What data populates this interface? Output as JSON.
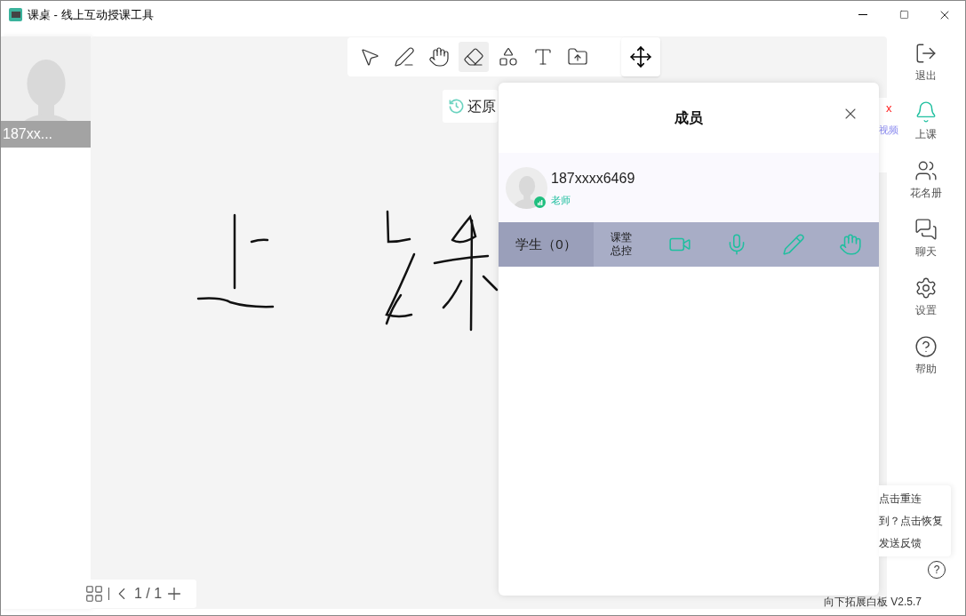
{
  "window": {
    "title": "课桌 - 线上互动授课工具"
  },
  "video_tile": {
    "name": "187xx..."
  },
  "toolbar": {
    "tools": [
      {
        "kind": "select",
        "selected": false
      },
      {
        "kind": "pen",
        "selected": false
      },
      {
        "kind": "hand",
        "selected": false
      },
      {
        "kind": "eraser",
        "selected": true
      },
      {
        "kind": "shapes",
        "selected": false
      },
      {
        "kind": "text",
        "selected": false
      },
      {
        "kind": "upload",
        "selected": false
      }
    ]
  },
  "restore_button": {
    "label": "还原"
  },
  "side_card": {
    "close": "x",
    "label": "视频"
  },
  "members_panel": {
    "title": "成员",
    "teacher": {
      "name": "187xxxx6469",
      "role": "老师"
    },
    "students_tab": {
      "label": "学生（0）"
    },
    "class_control": {
      "label": "课堂总控"
    },
    "controls": [
      {
        "kind": "camera"
      },
      {
        "kind": "mic"
      },
      {
        "kind": "pen"
      },
      {
        "kind": "hand"
      }
    ]
  },
  "sidebar": {
    "items": [
      {
        "label": "退出",
        "kind": "exit",
        "active": false
      },
      {
        "label": "上课",
        "kind": "bell",
        "active": true
      },
      {
        "label": "花名册",
        "kind": "roster",
        "active": false
      },
      {
        "label": "聊天",
        "kind": "chat",
        "active": false
      },
      {
        "label": "设置",
        "kind": "settings",
        "active": false
      },
      {
        "label": "帮助",
        "kind": "help",
        "active": false
      }
    ]
  },
  "help_card": {
    "lines": [
      "点击重连",
      "到？点击恢复",
      "发送反馈"
    ]
  },
  "help_button": {
    "label": "?"
  },
  "version": "向下拓展白板 V2.5.7",
  "pager": {
    "page": "1 / 1"
  }
}
